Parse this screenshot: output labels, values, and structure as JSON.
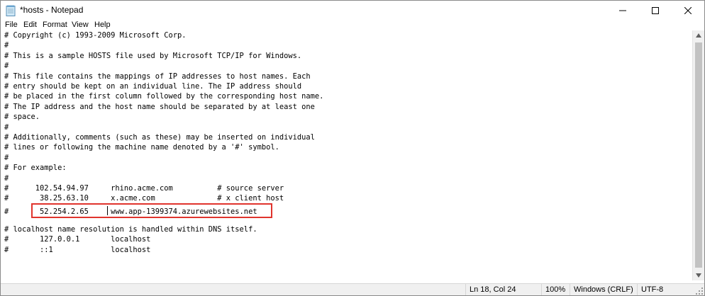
{
  "window": {
    "title": "*hosts - Notepad"
  },
  "menubar": [
    "File",
    "Edit",
    "Format",
    "View",
    "Help"
  ],
  "editor": {
    "lines": [
      "# Copyright (c) 1993-2009 Microsoft Corp.",
      "#",
      "# This is a sample HOSTS file used by Microsoft TCP/IP for Windows.",
      "#",
      "# This file contains the mappings of IP addresses to host names. Each",
      "# entry should be kept on an individual line. The IP address should",
      "# be placed in the first column followed by the corresponding host name.",
      "# The IP address and the host name should be separated by at least one",
      "# space.",
      "#",
      "# Additionally, comments (such as these) may be inserted on individual",
      "# lines or following the machine name denoted by a '#' symbol.",
      "#",
      "# For example:",
      "#",
      "#      102.54.94.97     rhino.acme.com          # source server",
      "#       38.25.63.10     x.acme.com              # x client host",
      "#       52.254.2.65     www.app-1399374.azurewebsites.net",
      "",
      "# localhost name resolution is handled within DNS itself.",
      "#       127.0.0.1       localhost",
      "#       ::1             localhost"
    ]
  },
  "statusbar": {
    "position": "Ln 18, Col 24",
    "zoom": "100%",
    "line_ending": "Windows (CRLF)",
    "encoding": "UTF-8"
  },
  "colors": {
    "highlight": "#e0342d"
  }
}
